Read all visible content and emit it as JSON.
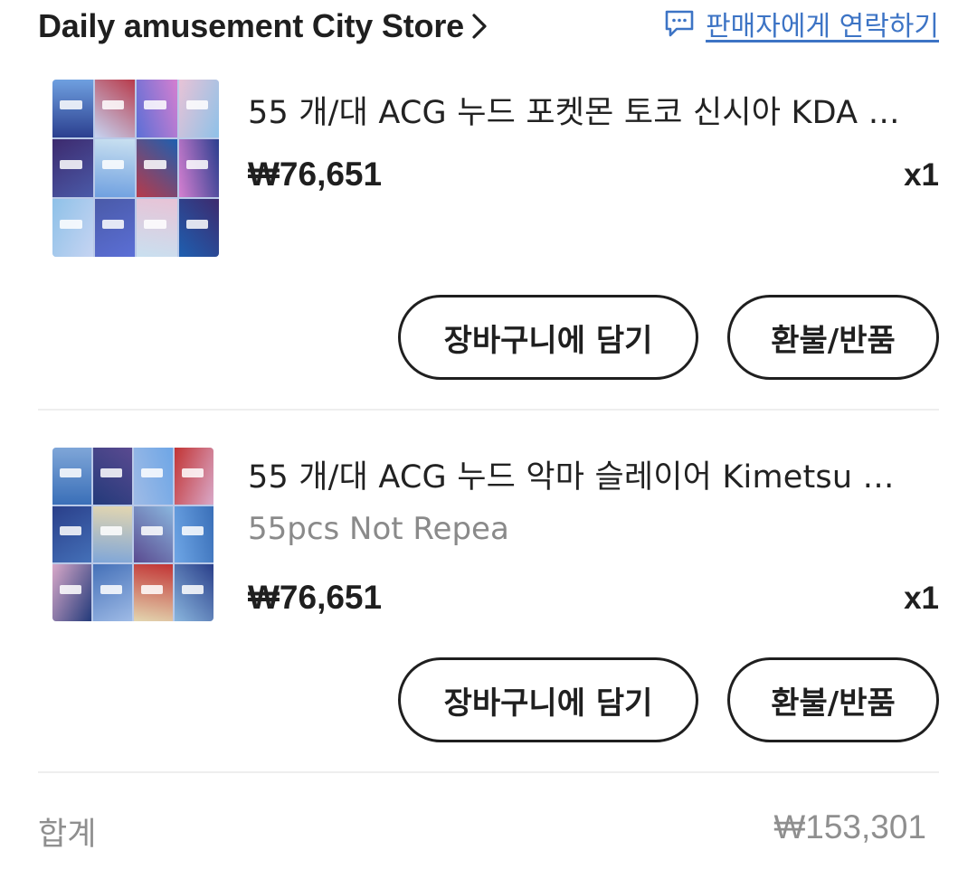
{
  "header": {
    "store_name": "Daily amusement City Store",
    "contact_label": "판매자에게 연락하기",
    "chevron_icon": "chevron-right-icon",
    "contact_icon": "chat-bubble-icon"
  },
  "items": [
    {
      "title": "55 개/대 ACG 누드 포켓몬 토코 신시아 KDA …",
      "subtitle": "",
      "price": "₩76,651",
      "quantity": "x1",
      "thumbnail_colors": [
        "#2b3f8f",
        "#c6d4f2",
        "#5b6fd6",
        "#e8c3d6",
        "#3d2a6e",
        "#6fa0e0",
        "#b83a4a",
        "#d47fd0",
        "#8ec1e8",
        "#4a5aa8",
        "#c9e0f0",
        "#1e5fb0"
      ],
      "add_to_cart_label": "장바구니에 담기",
      "refund_label": "환불/반품"
    },
    {
      "title": "55 개/대 ACG 누드 악마 슬레이어 Kimetsu …",
      "subtitle": "55pcs Not Repea",
      "price": "₩76,651",
      "quantity": "x1",
      "thumbnail_colors": [
        "#3a6fb8",
        "#233a7a",
        "#9fbbe6",
        "#c23434",
        "#2a3f8a",
        "#7fa6d8",
        "#5a4a90",
        "#6ea6e6",
        "#d9a9c9",
        "#4470b8",
        "#e3d6b0",
        "#8ab6de"
      ],
      "add_to_cart_label": "장바구니에 담기",
      "refund_label": "환불/반품"
    }
  ],
  "summary": {
    "total_label": "합계",
    "total_value": "₩153,301"
  },
  "colors": {
    "link_blue": "#3d74c5",
    "text_dark": "#1f1f1f",
    "text_muted": "#8f8f8f",
    "divider": "#eeeeee"
  }
}
